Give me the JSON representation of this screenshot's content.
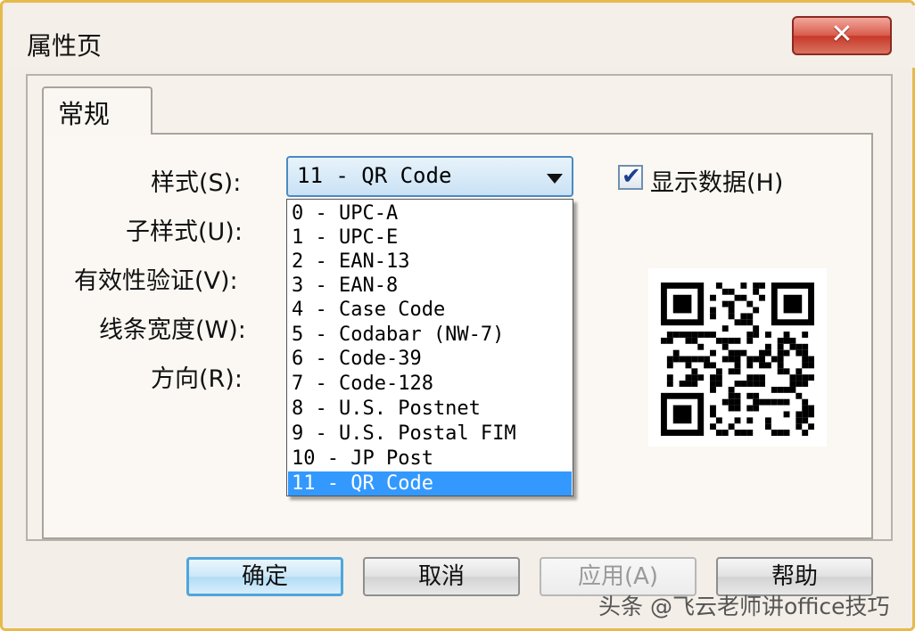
{
  "window": {
    "title": "属性页",
    "close_symbol": "✕"
  },
  "tabs": [
    {
      "label": "常规"
    }
  ],
  "form": {
    "labels": {
      "style": "样式(S):",
      "substyle": "子样式(U):",
      "validation": "有效性验证(V):",
      "line_width": "线条宽度(W):",
      "direction": "方向(R):"
    },
    "style_combo": {
      "value": "11 - QR Code",
      "options": [
        "0 - UPC-A",
        "1 - UPC-E",
        "2 - EAN-13",
        "3 - EAN-8",
        "4 - Case Code",
        "5 - Codabar (NW-7)",
        "6 - Code-39",
        "7 - Code-128",
        "8 - U.S. Postnet",
        "9 - U.S. Postal FIM",
        "10 - JP Post",
        "11 - QR Code"
      ],
      "selected_index": 11
    },
    "show_data": {
      "label": "显示数据(H)",
      "checked": true,
      "check_mark": "✔"
    }
  },
  "buttons": {
    "ok": "确定",
    "cancel": "取消",
    "apply": "应用(A)",
    "help": "帮助"
  },
  "watermark": "头条 @飞云老师讲office技巧",
  "colors": {
    "frame_border": "#e7b94d",
    "selection": "#3399ff",
    "close_button": "#c8382a"
  }
}
